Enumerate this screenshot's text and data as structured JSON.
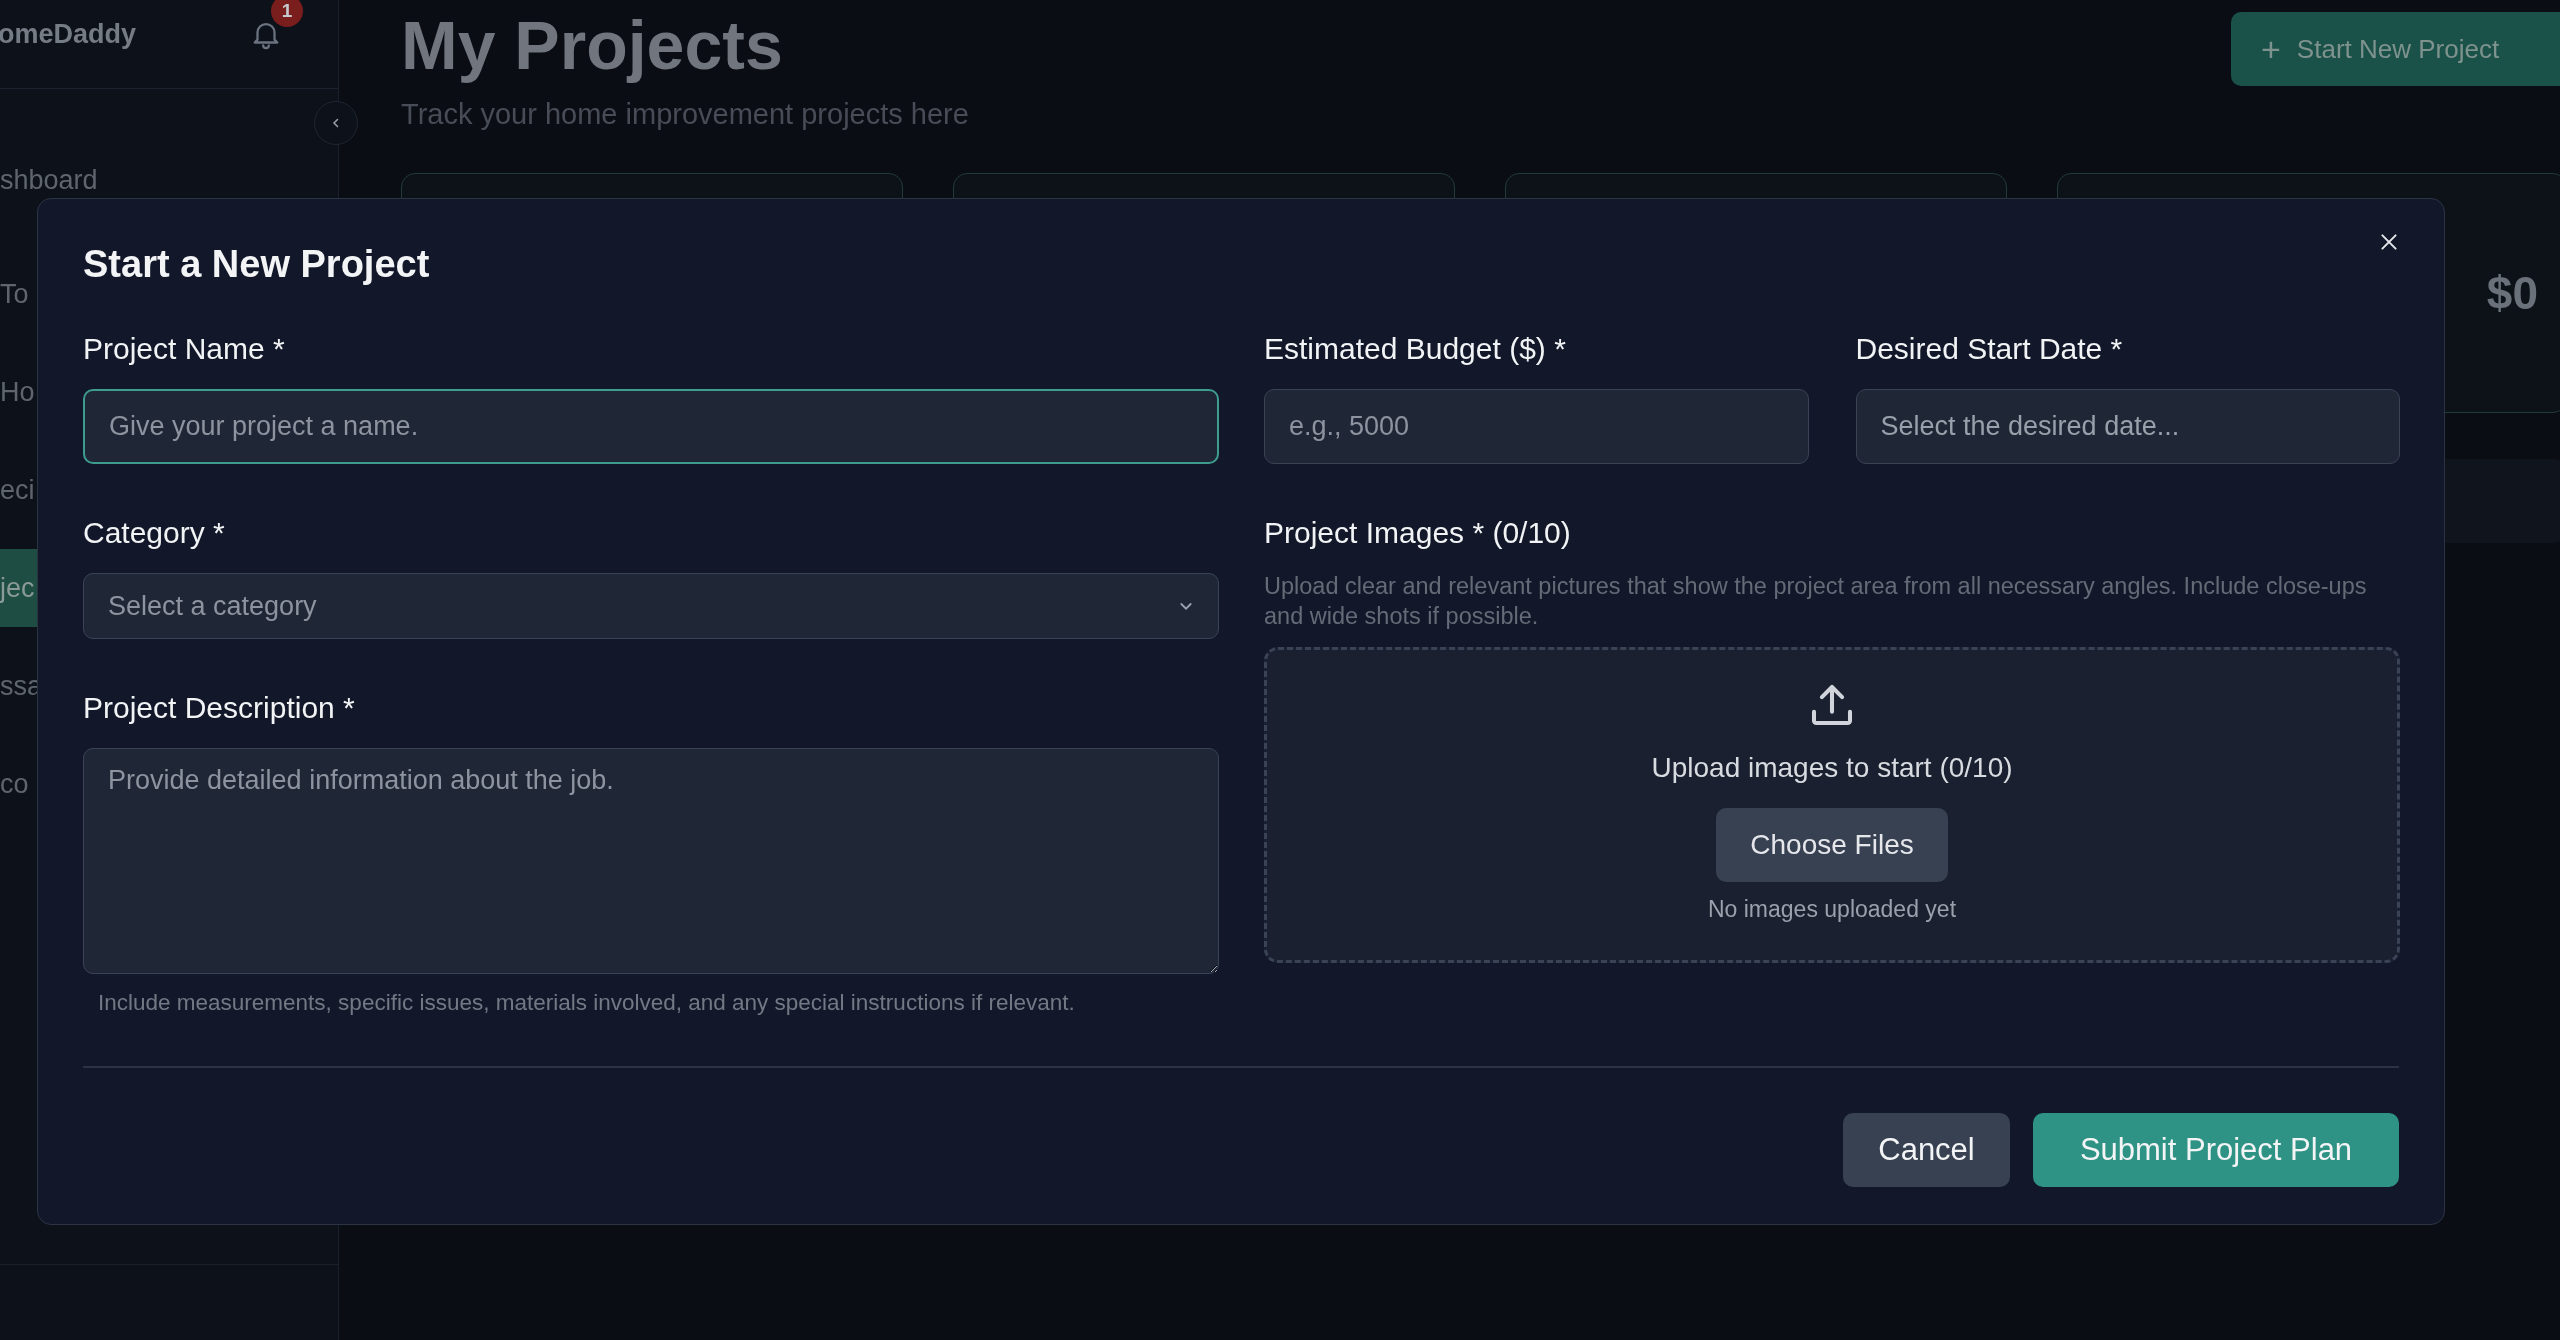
{
  "sidebar": {
    "brand": "omeDaddy",
    "notification_count": "1",
    "items": [
      {
        "label": "shboard",
        "selected": false
      },
      {
        "label": "To",
        "selected": false
      },
      {
        "label": "Ho",
        "selected": false
      },
      {
        "label": "eci",
        "selected": false
      },
      {
        "label": "jec",
        "selected": true
      },
      {
        "label": "ssa",
        "selected": false
      },
      {
        "label": "co",
        "selected": false
      }
    ]
  },
  "header": {
    "title": "My Projects",
    "subtitle": "Track your home improvement projects here",
    "new_button": {
      "icon": "+",
      "label": "Start New Project"
    }
  },
  "stats": {
    "visible_value": "$0"
  },
  "modal": {
    "title": "Start a New Project",
    "left_fields": [
      {
        "kind": "text",
        "label": "Project Name *",
        "placeholder": "Give your project a name.",
        "focused": true
      },
      {
        "kind": "select",
        "label": "Category *",
        "placeholder": "Select a category",
        "focused": false
      },
      {
        "kind": "textarea",
        "label": "Project Description *",
        "placeholder": "Provide detailed information about the job.",
        "focused": false,
        "hint": "Include measurements, specific issues, materials involved, and any special instructions if relevant."
      }
    ],
    "right_fields": [
      {
        "kind": "text",
        "label": "Estimated Budget ($) *",
        "placeholder": "e.g., 5000",
        "focused": false
      },
      {
        "kind": "date",
        "label": "Desired Start Date *",
        "placeholder": "Select the desired date...",
        "focused": false
      }
    ],
    "images": {
      "label": "Project Images * (0/10)",
      "help": "Upload clear and relevant pictures that show the project area from all necessary angles. Include close-ups and wide shots if possible.",
      "prompt": "Upload images to start (0/10)",
      "button": "Choose Files",
      "empty": "No images uploaded yet"
    },
    "buttons": [
      {
        "kind": "secondary",
        "label": "Cancel"
      },
      {
        "kind": "primary",
        "label": "Submit Project Plan"
      }
    ]
  }
}
